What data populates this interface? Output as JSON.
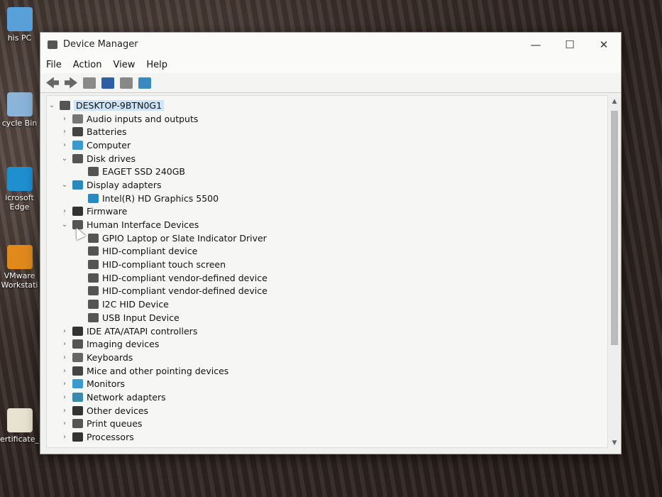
{
  "desktop": {
    "icons": [
      {
        "label": "his PC",
        "color": "#5aa0d8"
      },
      {
        "label": "cycle Bin",
        "color": "#8ab4d8"
      },
      {
        "label": "icrosoft Edge",
        "color": "#1f8fd0"
      },
      {
        "label": "VMware Workstati",
        "color": "#e08a1e"
      },
      {
        "label": "ertificate_s...",
        "color": "#e8e2d0"
      }
    ]
  },
  "window": {
    "title": "Device Manager",
    "minimize": "—",
    "maximize": "☐",
    "close": "✕",
    "menu": [
      "File",
      "Action",
      "View",
      "Help"
    ]
  },
  "tree": {
    "root": "DESKTOP-9BTN0G1",
    "rows": [
      {
        "label": "Audio inputs and outputs",
        "level": 1,
        "state": "collapsed",
        "color": "#777"
      },
      {
        "label": "Batteries",
        "level": 1,
        "state": "collapsed",
        "color": "#444"
      },
      {
        "label": "Computer",
        "level": 1,
        "state": "collapsed",
        "color": "#3a9ad0"
      },
      {
        "label": "Disk drives",
        "level": 1,
        "state": "expanded",
        "color": "#555"
      },
      {
        "label": "EAGET SSD 240GB",
        "level": 2,
        "state": "leaf",
        "color": "#555"
      },
      {
        "label": "Display adapters",
        "level": 1,
        "state": "expanded",
        "color": "#2a8ac0"
      },
      {
        "label": "Intel(R) HD Graphics 5500",
        "level": 2,
        "state": "leaf",
        "color": "#2a8ac0"
      },
      {
        "label": "Firmware",
        "level": 1,
        "state": "collapsed",
        "color": "#333"
      },
      {
        "label": "Human Interface Devices",
        "level": 1,
        "state": "expanded",
        "color": "#555"
      },
      {
        "label": "GPIO Laptop or Slate Indicator Driver",
        "level": 2,
        "state": "leaf",
        "color": "#555"
      },
      {
        "label": "HID-compliant device",
        "level": 2,
        "state": "leaf",
        "color": "#555"
      },
      {
        "label": "HID-compliant touch screen",
        "level": 2,
        "state": "leaf",
        "color": "#555"
      },
      {
        "label": "HID-compliant vendor-defined device",
        "level": 2,
        "state": "leaf",
        "color": "#555"
      },
      {
        "label": "HID-compliant vendor-defined device",
        "level": 2,
        "state": "leaf",
        "color": "#555"
      },
      {
        "label": "I2C HID Device",
        "level": 2,
        "state": "leaf",
        "color": "#555"
      },
      {
        "label": "USB Input Device",
        "level": 2,
        "state": "leaf",
        "color": "#555"
      },
      {
        "label": "IDE ATA/ATAPI controllers",
        "level": 1,
        "state": "collapsed",
        "color": "#333"
      },
      {
        "label": "Imaging devices",
        "level": 1,
        "state": "collapsed",
        "color": "#555"
      },
      {
        "label": "Keyboards",
        "level": 1,
        "state": "collapsed",
        "color": "#666"
      },
      {
        "label": "Mice and other pointing devices",
        "level": 1,
        "state": "collapsed",
        "color": "#444"
      },
      {
        "label": "Monitors",
        "level": 1,
        "state": "collapsed",
        "color": "#3a9ad0"
      },
      {
        "label": "Network adapters",
        "level": 1,
        "state": "collapsed",
        "color": "#3a8ab0"
      },
      {
        "label": "Other devices",
        "level": 1,
        "state": "collapsed",
        "color": "#333"
      },
      {
        "label": "Print queues",
        "level": 1,
        "state": "collapsed",
        "color": "#555"
      },
      {
        "label": "Processors",
        "level": 1,
        "state": "collapsed",
        "color": "#333"
      }
    ]
  }
}
